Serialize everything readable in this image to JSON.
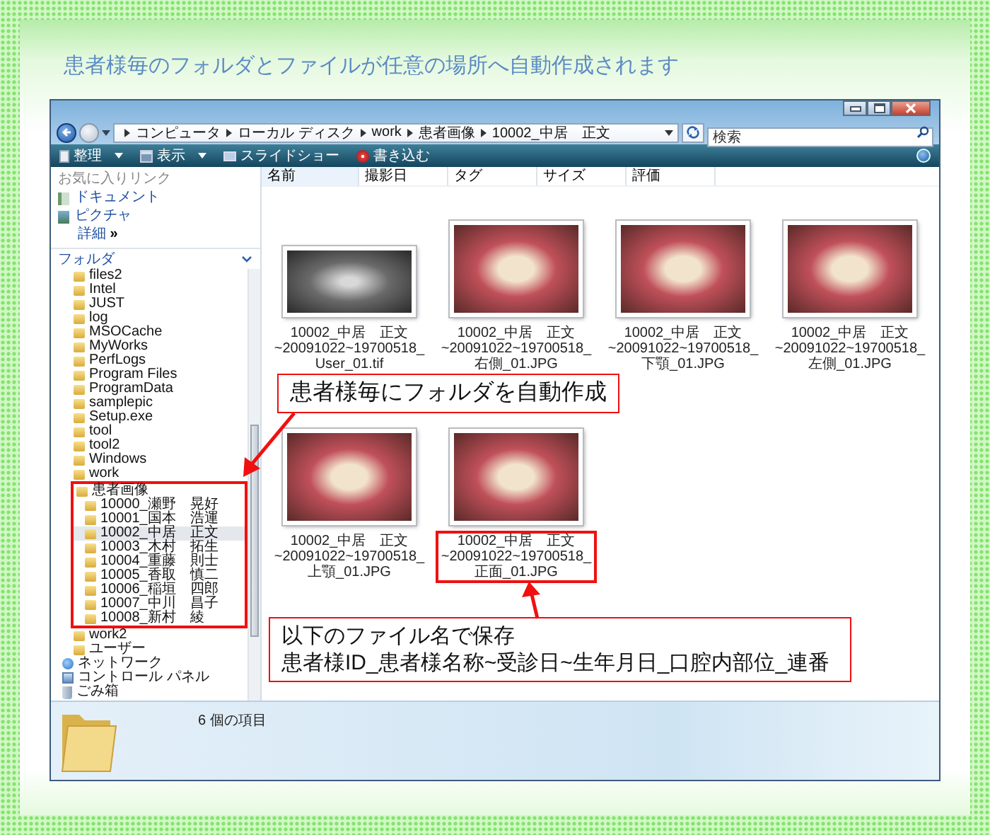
{
  "heading": "患者様毎のフォルダとファイルが任意の場所へ自動作成されます",
  "window": {
    "breadcrumbs": [
      "コンピュータ",
      "ローカル ディスク",
      "work",
      "患者画像",
      "10002_中居　正文"
    ],
    "search": {
      "placeholder": "検索"
    },
    "toolbar": [
      {
        "label": "整理",
        "kind": "organize",
        "dropdown": true
      },
      {
        "label": "表示",
        "kind": "views",
        "dropdown": true
      },
      {
        "label": "スライドショー",
        "kind": "slideshow",
        "dropdown": false
      },
      {
        "label": "書き込む",
        "kind": "burn",
        "dropdown": false
      }
    ],
    "favorites": {
      "title": "お気に入りリンク",
      "items": [
        {
          "label": "ドキュメント",
          "kind": "documents"
        },
        {
          "label": "ピクチャ",
          "kind": "pictures"
        }
      ],
      "more": {
        "label": "詳細",
        "glyph": "»"
      }
    },
    "folders": {
      "title": "フォルダ",
      "tree": [
        {
          "kind": "group",
          "children": [
            {
              "label": "files2",
              "kind": "folder",
              "selected": false
            },
            {
              "label": "Intel",
              "kind": "folder",
              "selected": false
            },
            {
              "label": "JUST",
              "kind": "folder",
              "selected": false
            },
            {
              "label": "log",
              "kind": "folder",
              "selected": false
            },
            {
              "label": "MSOCache",
              "kind": "folder",
              "selected": false
            },
            {
              "label": "MyWorks",
              "kind": "folder",
              "selected": false
            },
            {
              "label": "PerfLogs",
              "kind": "folder",
              "selected": false
            },
            {
              "label": "Program Files",
              "kind": "folder",
              "selected": false
            },
            {
              "label": "ProgramData",
              "kind": "folder",
              "selected": false
            },
            {
              "label": "samplepic",
              "kind": "folder",
              "selected": false
            },
            {
              "label": "Setup.exe",
              "kind": "folder",
              "selected": false
            },
            {
              "label": "tool",
              "kind": "folder",
              "selected": false
            },
            {
              "label": "tool2",
              "kind": "folder",
              "selected": false
            },
            {
              "label": "Windows",
              "kind": "folder",
              "selected": false
            },
            {
              "label": "work",
              "kind": "folder",
              "selected": false,
              "children": [
                {
                  "label": "患者画像",
                  "kind": "folder",
                  "selected": false,
                  "highlighted": true,
                  "children": [
                    {
                      "label": "10000_瀬野　晃好",
                      "kind": "folder",
                      "selected": false
                    },
                    {
                      "label": "10001_国本　浩運",
                      "kind": "folder",
                      "selected": false
                    },
                    {
                      "label": "10002_中居　正文",
                      "kind": "folder",
                      "selected": true
                    },
                    {
                      "label": "10003_木村　拓生",
                      "kind": "folder",
                      "selected": false
                    },
                    {
                      "label": "10004_重藤　則士",
                      "kind": "folder",
                      "selected": false
                    },
                    {
                      "label": "10005_香取　慎二",
                      "kind": "folder",
                      "selected": false
                    },
                    {
                      "label": "10006_稲垣　四郎",
                      "kind": "folder",
                      "selected": false
                    },
                    {
                      "label": "10007_中川　昌子",
                      "kind": "folder",
                      "selected": false
                    },
                    {
                      "label": "10008_新村　綾",
                      "kind": "folder",
                      "selected": false
                    }
                  ]
                }
              ]
            },
            {
              "label": "work2",
              "kind": "folder",
              "selected": false
            },
            {
              "label": "ユーザー",
              "kind": "folder",
              "selected": false
            }
          ]
        },
        {
          "label": "ネットワーク",
          "kind": "network",
          "selected": false
        },
        {
          "label": "コントロール パネル",
          "kind": "control-panel",
          "selected": false
        },
        {
          "label": "ごみ箱",
          "kind": "recycle-bin",
          "selected": false
        }
      ]
    },
    "columns": [
      "名前",
      "撮影日",
      "タグ",
      "サイズ",
      "評価"
    ],
    "files": [
      {
        "kind": "xray",
        "name": "10002_中居　正文",
        "detail": "~20091022~19700518_User_01.tif",
        "highlighted": false
      },
      {
        "kind": "photo",
        "name": "10002_中居　正文",
        "detail": "~20091022~19700518_右側_01.JPG",
        "highlighted": false
      },
      {
        "kind": "photo",
        "name": "10002_中居　正文",
        "detail": "~20091022~19700518_下顎_01.JPG",
        "highlighted": false
      },
      {
        "kind": "photo",
        "name": "10002_中居　正文",
        "detail": "~20091022~19700518_左側_01.JPG",
        "highlighted": false
      },
      {
        "kind": "photo",
        "name": "10002_中居　正文",
        "detail": "~20091022~19700518_上顎_01.JPG",
        "highlighted": false
      },
      {
        "kind": "photo",
        "name": "10002_中居　正文",
        "detail": "~20091022~19700518_正面_01.JPG",
        "highlighted": true
      }
    ],
    "status": "6 個の項目"
  },
  "callouts": [
    {
      "lines": [
        "患者様毎にフォルダを自動作成"
      ]
    },
    {
      "lines": [
        "以下のファイル名で保存",
        "患者様ID_患者様名称~受診日~生年月日_口腔内部位_連番"
      ]
    }
  ]
}
